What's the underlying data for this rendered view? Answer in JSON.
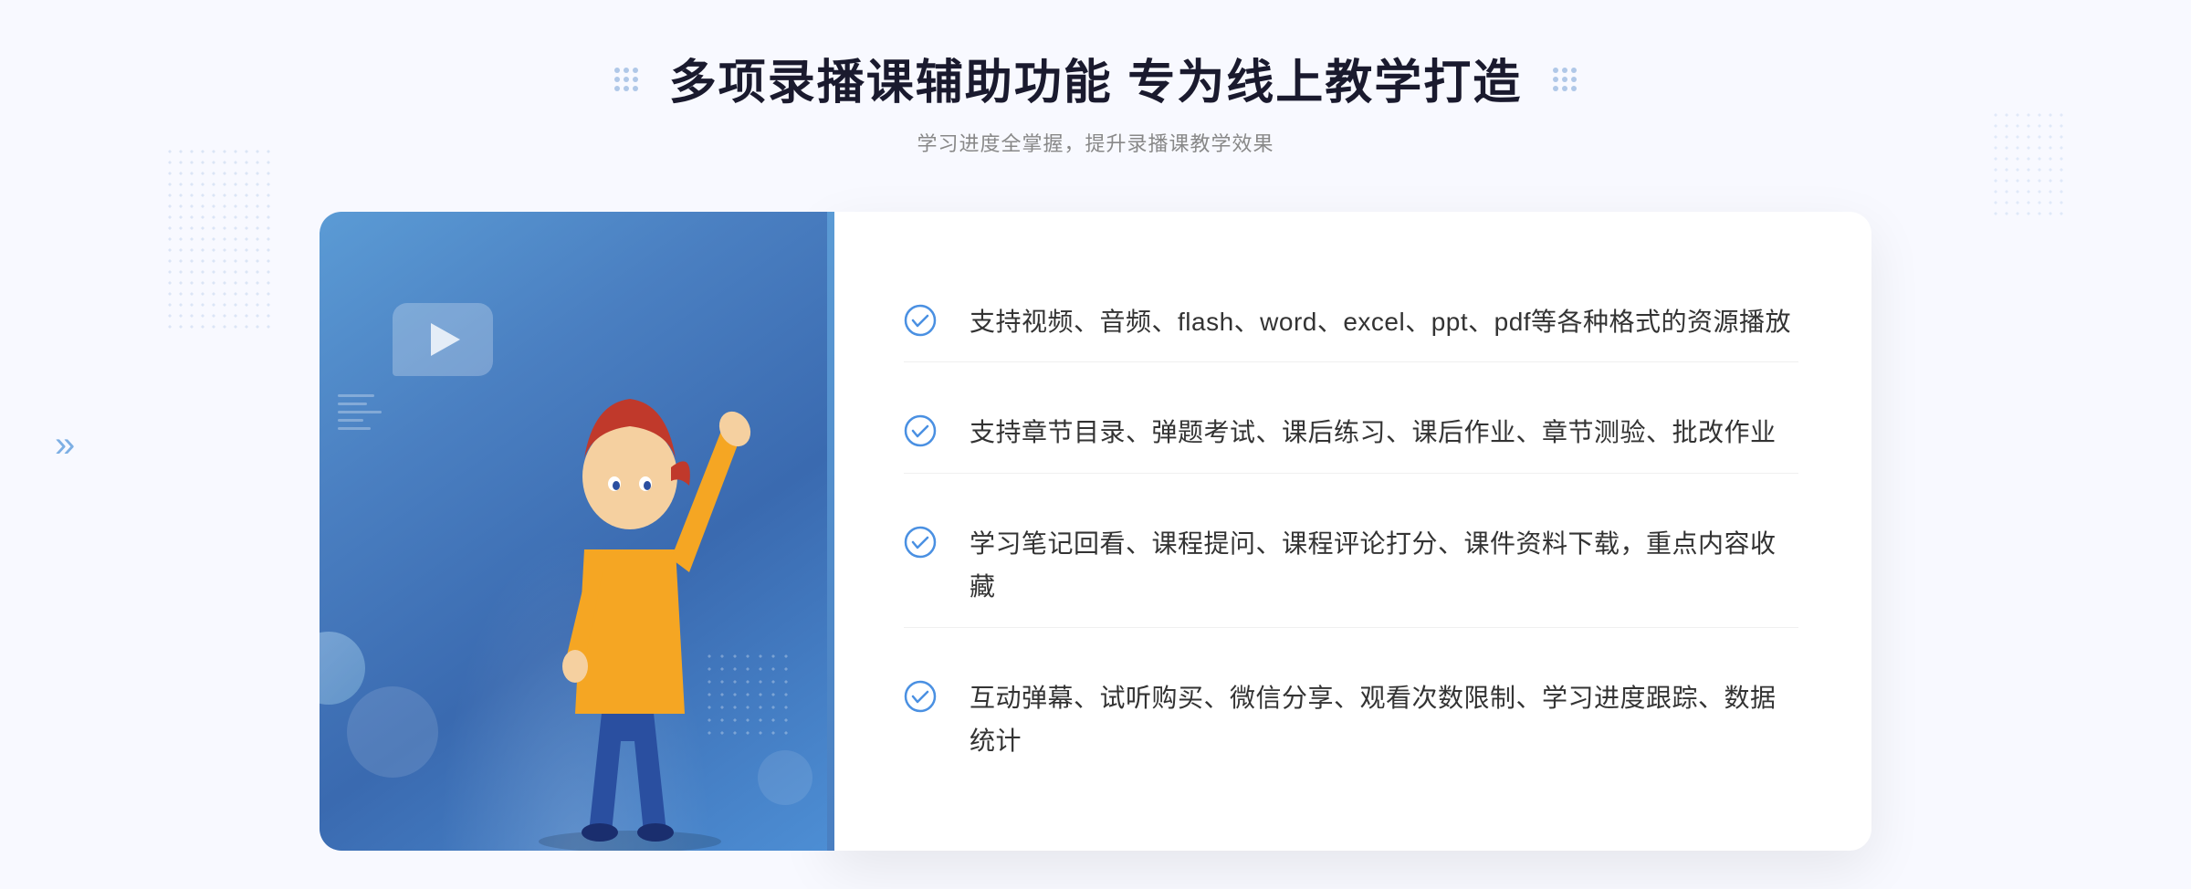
{
  "header": {
    "title": "多项录播课辅助功能 专为线上教学打造",
    "subtitle": "学习进度全掌握，提升录播课教学效果"
  },
  "features": [
    {
      "id": "feature-1",
      "text": "支持视频、音频、flash、word、excel、ppt、pdf等各种格式的资源播放"
    },
    {
      "id": "feature-2",
      "text": "支持章节目录、弹题考试、课后练习、课后作业、章节测验、批改作业"
    },
    {
      "id": "feature-3",
      "text": "学习笔记回看、课程提问、课程评论打分、课件资料下载，重点内容收藏"
    },
    {
      "id": "feature-4",
      "text": "互动弹幕、试听购买、微信分享、观看次数限制、学习进度跟踪、数据统计"
    }
  ],
  "decoration": {
    "chevron_left": "»",
    "play_alt": "播放"
  }
}
